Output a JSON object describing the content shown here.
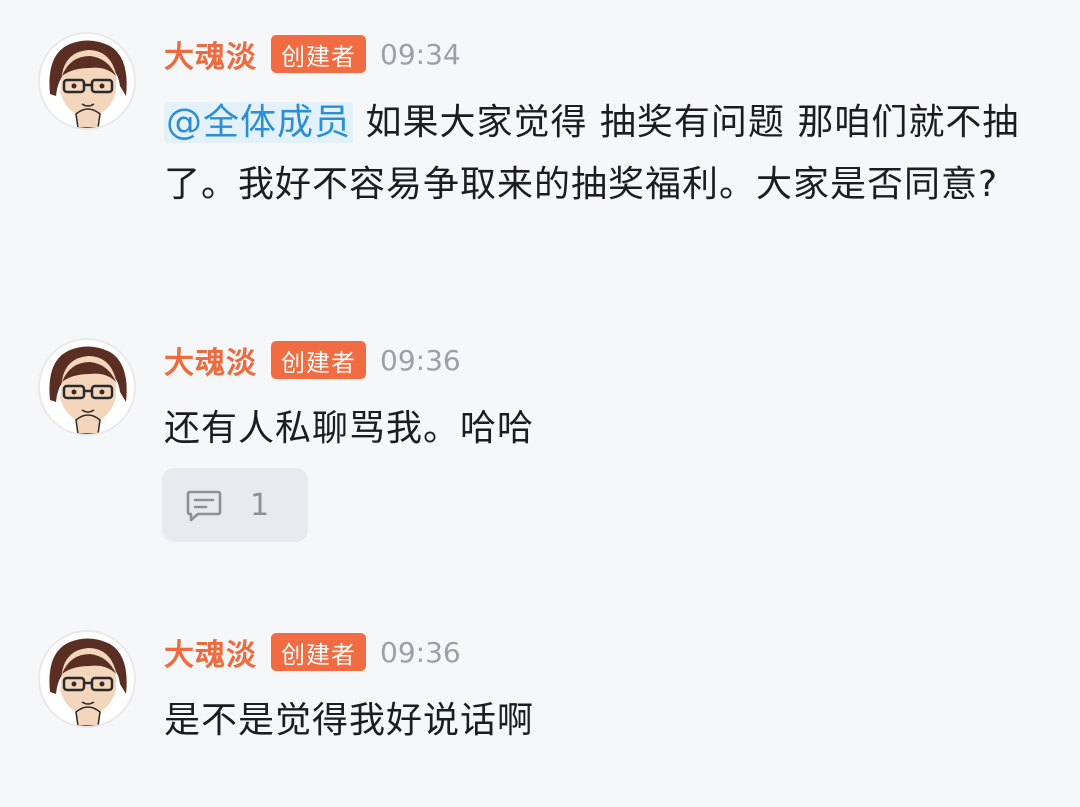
{
  "messages": [
    {
      "sender": "大魂淡",
      "role_badge": "创建者",
      "time": "09:34",
      "mention": "@全体成员",
      "text": " 如果大家觉得 抽奖有问题  那咱们就不抽了。我好不容易争取来的抽奖福利。大家是否同意?"
    },
    {
      "sender": "大魂淡",
      "role_badge": "创建者",
      "time": "09:36",
      "text": "还有人私聊骂我。哈哈",
      "reply_count": "1",
      "reply_icon": "comment-icon"
    },
    {
      "sender": "大魂淡",
      "role_badge": "创建者",
      "time": "09:36",
      "text": "是不是觉得我好说话啊"
    }
  ],
  "colors": {
    "background": "#f6f7f9",
    "sender_name": "#ee6a3f",
    "badge": "#f26c43",
    "mention_text": "#2b8fd6",
    "mention_bg": "#e3f1fb",
    "time": "#9ea0a6"
  }
}
